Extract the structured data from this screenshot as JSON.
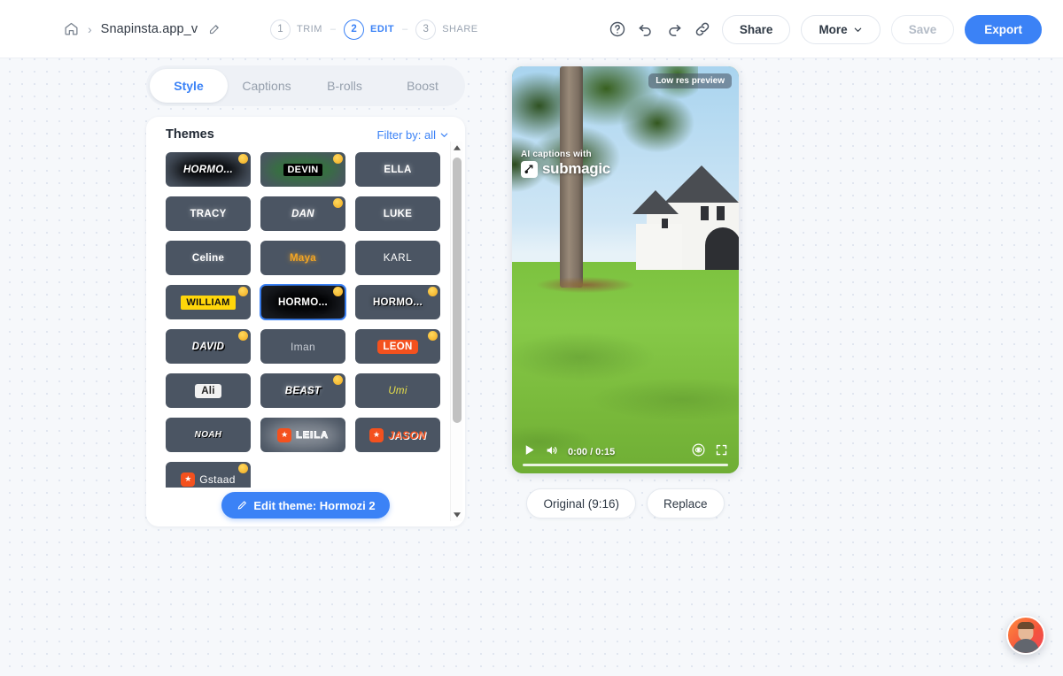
{
  "header": {
    "home_icon": "home-icon",
    "separator": "›",
    "project_name": "Snapinsta.app_v",
    "edit_icon": "edit-pencil-icon",
    "steps": [
      {
        "num": "1",
        "label": "TRIM",
        "active": false
      },
      {
        "num": "2",
        "label": "EDIT",
        "active": true
      },
      {
        "num": "3",
        "label": "SHARE",
        "active": false
      }
    ],
    "step_dash": "–",
    "icons": [
      "help-circle-icon",
      "undo-icon",
      "redo-icon",
      "link-icon"
    ],
    "share_label": "Share",
    "more_label": "More",
    "save_label": "Save",
    "export_label": "Export",
    "accent_color": "#3b82f6"
  },
  "tabs": [
    {
      "label": "Style",
      "active": true
    },
    {
      "label": "Captions",
      "active": false
    },
    {
      "label": "B-rolls",
      "active": false
    },
    {
      "label": "Boost",
      "active": false
    }
  ],
  "panel": {
    "title": "Themes",
    "filter_label": "Filter by: all",
    "edit_theme_label": "Edit theme: Hormozi 2",
    "edit_theme_icon": "brush-icon",
    "themes": [
      {
        "label": "HORMO...",
        "style": "hormozi1",
        "badge": "😀",
        "selected": false
      },
      {
        "label": "DEVIN",
        "style": "devin",
        "badge": "😀",
        "selected": false
      },
      {
        "label": "ELLA",
        "style": "plain",
        "badge": "",
        "selected": false
      },
      {
        "label": "TRACY",
        "style": "plain",
        "badge": "",
        "selected": false
      },
      {
        "label": "DAN",
        "style": "italic",
        "badge": "😀",
        "selected": false
      },
      {
        "label": "LUKE",
        "style": "plain",
        "badge": "",
        "selected": false
      },
      {
        "label": "Celine",
        "style": "celine",
        "badge": "",
        "selected": false
      },
      {
        "label": "Maya",
        "style": "maya",
        "badge": "",
        "selected": false
      },
      {
        "label": "KARL",
        "style": "karl",
        "badge": "",
        "selected": false
      },
      {
        "label": "WILLIAM",
        "style": "william",
        "badge": "😀",
        "selected": false
      },
      {
        "label": "HORMO...",
        "style": "hormozi2",
        "badge": "😀",
        "selected": true
      },
      {
        "label": "HORMO...",
        "style": "hormozi3",
        "badge": "😀",
        "selected": false
      },
      {
        "label": "DAVID",
        "style": "david",
        "badge": "😀",
        "selected": false
      },
      {
        "label": "Iman",
        "style": "iman",
        "badge": "",
        "selected": false
      },
      {
        "label": "LEON",
        "style": "leon",
        "badge": "😀",
        "selected": false
      },
      {
        "label": "Ali",
        "style": "ali",
        "badge": "",
        "selected": false
      },
      {
        "label": "BEAST",
        "style": "beast",
        "badge": "😀",
        "selected": false
      },
      {
        "label": "Umi",
        "style": "umi",
        "badge": "",
        "selected": false
      },
      {
        "label": "NOAH",
        "style": "noah",
        "badge": "",
        "selected": false
      },
      {
        "label": "LEILA",
        "style": "leila",
        "badge": "",
        "selected": false,
        "star": true
      },
      {
        "label": "JASON",
        "style": "jason",
        "badge": "",
        "selected": false,
        "star": true
      },
      {
        "label": "Gstaad",
        "style": "gstaad",
        "badge": "😀",
        "selected": false,
        "star": true
      }
    ]
  },
  "preview": {
    "lowres_badge": "Low res preview",
    "watermark_line1": "AI captions with",
    "watermark_brand": "submagic",
    "play_icon": "play-icon",
    "volume_icon": "volume-icon",
    "time": "0:00 / 0:15",
    "eye_icon": "eye-icon",
    "fullscreen_icon": "fullscreen-icon",
    "ratio_label": "Original (9:16)",
    "replace_label": "Replace"
  },
  "support": {
    "avatar": "support-avatar"
  }
}
